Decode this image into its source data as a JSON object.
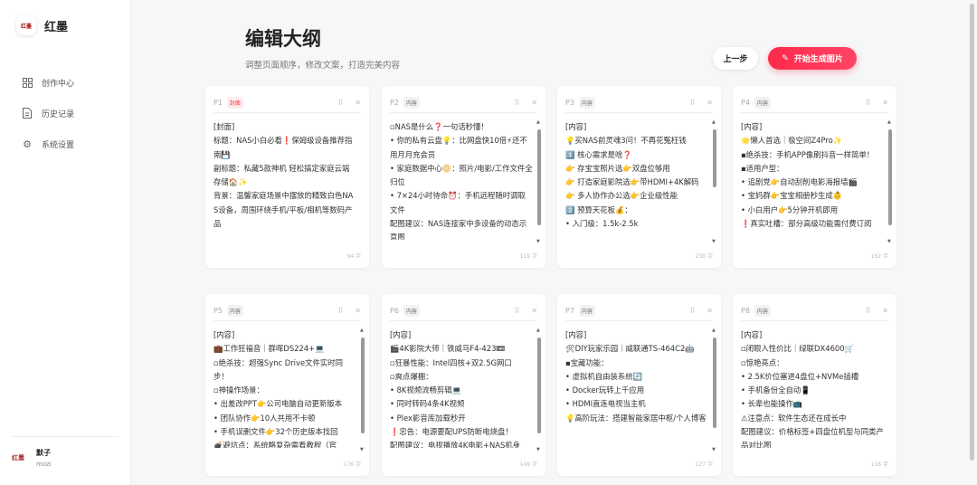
{
  "sidebar": {
    "logo_mark": "红墨",
    "app_name": "红墨",
    "items": [
      {
        "label": "创作中心",
        "icon": "grid-icon"
      },
      {
        "label": "历史记录",
        "icon": "document-icon"
      },
      {
        "label": "系统设置",
        "icon": "gear-icon"
      }
    ],
    "user": {
      "avatar": "红墨",
      "name": "默子",
      "id": "mozi"
    }
  },
  "header": {
    "title": "编辑大纲",
    "subtitle": "调整页面顺序，修改文案，打造完美内容",
    "prev_label": "上一步",
    "generate_label": "开始生成图片"
  },
  "colors": {
    "accent": "#ff2a4a"
  },
  "cards": [
    {
      "page": "P1",
      "tag": "封面",
      "cover": true,
      "count": "94 字",
      "scroll": false,
      "text": "[封面]\n标题：NAS小白必看❗保姆级设备推荐指南💾\n副标题：私藏5款神机 轻松搞定家庭云端存储🏠✨\n背景：温馨家庭场景中摆放的精致白色NAS设备，周围环绕手机/平板/相机等数码产品"
    },
    {
      "page": "P2",
      "tag": "内容",
      "cover": false,
      "count": "119 字",
      "scroll": true,
      "text": "▫NAS是什么❓一句话秒懂！\n• 你的私有云盘💡：比网盘快10倍⚡还不用月月充会员\n• 家庭数据中心📀：照片/电影/工作文件全归位\n• 7×24小时待命⏰：手机远程随时调取文件\n配图建议：NAS连接家中多设备的动态示意图"
    },
    {
      "page": "P3",
      "tag": "内容",
      "cover": false,
      "count": "230 字",
      "scroll": true,
      "text": "[内容]\n💡买NAS前灵魂3问！不再花冤枉钱\n1️⃣ 核心需求是啥❓\n👉 存宝宝照片选👉双盘位够用\n👉 打造家庭影院选👉带HDMI+4K解码\n👉 多人协作办公选👉企业级性能\n2️⃣ 预算天花板💰：\n• 入门级：1.5k-2.5k"
    },
    {
      "page": "P4",
      "tag": "内容",
      "cover": false,
      "count": "162 字",
      "scroll": true,
      "text": "[内容]\n🌟懒人首选｜极空间Z4Pro✨\n▪绝杀技：手机APP像刷抖音一样简单！\n▪适用户型：\n• 追剧党👉自动刮削电影海报墙🎬\n• 宝妈群👉宝宝相册秒生成👶\n• 小白用户👉5分钟开机即用\n❗真实吐槽：部分高级功能需付费订阅"
    },
    {
      "page": "P5",
      "tag": "内容",
      "cover": false,
      "count": "176 字",
      "scroll": true,
      "text": "[内容]\n💼工作狂福音｜群晖DS224+💻\n▫绝杀技：超强Sync Drive文件实时同步！\n▫神操作场景：\n• 出差改PPT👉公司电脑自动更新版本\n• 团队协作👉10人共用不卡顿\n• 手机误删文件👉32个历史版本找回\n💣避坑点：系统略复杂需看教程（官"
    },
    {
      "page": "P6",
      "tag": "内容",
      "cover": false,
      "count": "149 字",
      "scroll": true,
      "text": "[内容]\n🎬4K影院大师｜铁威马F4-423📼\n▫狂暴性能：Intel四核+双2.5G网口\n▫爽点爆棚：\n• 8K视频流畅剪辑💻\n• 同时转码4条4K视频\n• Plex影音库加载秒开\n❗忠告：电源要配UPS防断电烧盘！\n配图建议：电视播放4K电影+NAS机身"
    },
    {
      "page": "P7",
      "tag": "内容",
      "cover": false,
      "count": "127 字",
      "scroll": true,
      "text": "[内容]\n🛠DIY玩家乐园｜威联通TS-464C2🤖\n▪宝藏功能：\n• 虚拟机自由装系统🔄\n• Docker玩转上千应用\n• HDMI直连电视当主机\n💡高阶玩法：搭建智能家居中枢/个人博客"
    },
    {
      "page": "P8",
      "tag": "内容",
      "cover": false,
      "count": "116 字",
      "scroll": false,
      "text": "[内容]\n▫闭眼入性价比｜绿联DX4600🛒\n▫惊艳亮点：\n• 2.5K价位塞进4盘位+NVMe插槽\n• 手机备份全自动📱\n• 长辈也能操作📺\n⚠注意点：软件生态还在成长中\n配图建议：价格标签+四盘位机型与同类产品对比图"
    }
  ]
}
